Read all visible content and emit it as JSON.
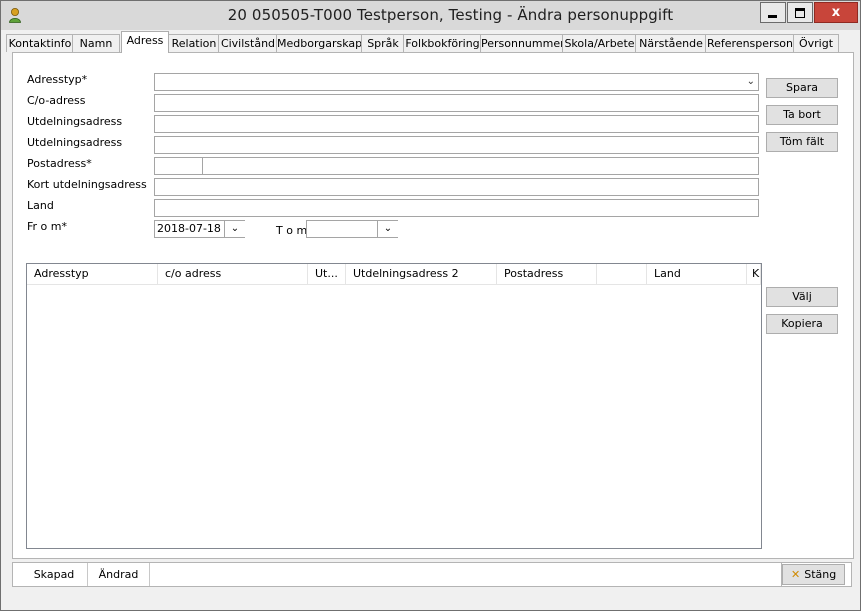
{
  "window": {
    "title": "20 050505-T000   Testperson, Testing   -   Ändra personuppgift",
    "close_glyph": "x"
  },
  "tabs": [
    {
      "label": "Kontaktinfo"
    },
    {
      "label": "Namn"
    },
    {
      "label": "Adress",
      "active": true
    },
    {
      "label": "Relation"
    },
    {
      "label": "Civilstånd"
    },
    {
      "label": "Medborgarskap"
    },
    {
      "label": "Språk"
    },
    {
      "label": "Folkbokföring"
    },
    {
      "label": "Personnummer"
    },
    {
      "label": "Skola/Arbete"
    },
    {
      "label": "Närstående"
    },
    {
      "label": "Referensperson"
    },
    {
      "label": "Övrigt"
    }
  ],
  "form": {
    "adresstyp_label": "Adresstyp*",
    "adresstyp_value": "",
    "co_label": "C/o-adress",
    "co_value": "",
    "utd1_label": "Utdelningsadress",
    "utd1_value": "",
    "utd2_label": "Utdelningsadress",
    "utd2_value": "",
    "postadress_label": "Postadress*",
    "postnr_value": "",
    "postort_value": "",
    "kort_label": "Kort utdelningsadress",
    "kort_value": "",
    "land_label": "Land",
    "land_value": "",
    "from_label": "Fr o m*",
    "from_value": "2018-07-18",
    "tom_label": "T o m",
    "tom_value": ""
  },
  "buttons": {
    "spara": "Spara",
    "ta_bort": "Ta bort",
    "tom_falt": "Töm fält",
    "valj": "Välj",
    "kopiera": "Kopiera",
    "stang": "Stäng"
  },
  "grid": {
    "columns": [
      "Adresstyp",
      "c/o adress",
      "Ut...",
      "Utdelningsadress 2",
      "Postadress",
      "",
      "Land",
      "K"
    ],
    "rows": []
  },
  "status": {
    "skapad": "Skapad",
    "andrad": "Ändrad",
    "info": ""
  },
  "colors": {
    "close_button": "#c8453a",
    "stang_icon": "#d08a00",
    "app_icon": "#d8a020"
  },
  "icons": {
    "app": "person-icon",
    "dropdown": "chevron-down-icon",
    "close": "close-icon",
    "minimize": "minimize-icon",
    "maximize": "maximize-icon"
  }
}
